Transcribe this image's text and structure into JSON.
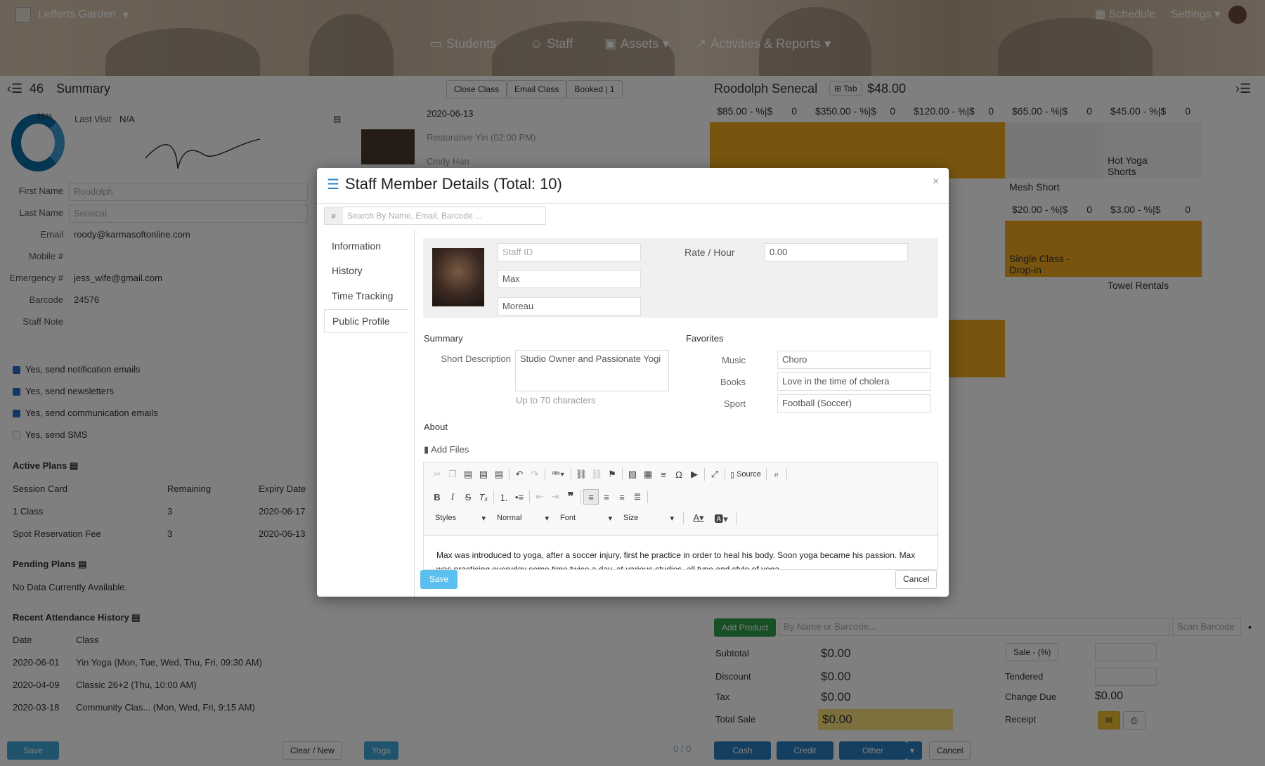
{
  "topbar": {
    "brand": "Lefferts Garden",
    "schedule": "Schedule",
    "settings": "Settings"
  },
  "mainnav": {
    "students": "Students",
    "staff": "Staff",
    "assets": "Assets",
    "activities": "Activities & Reports"
  },
  "left": {
    "count": "46",
    "title": "Summary",
    "percent": "29%",
    "last_visit_label": "Last Visit",
    "last_visit": "N/A",
    "fields": [
      {
        "label": "First Name",
        "value": "Roodolph"
      },
      {
        "label": "Last Name",
        "value": "Senecal"
      },
      {
        "label": "Email",
        "value": "roody@karmasoftonline.com"
      },
      {
        "label": "Mobile #",
        "value": ""
      },
      {
        "label": "Emergency #",
        "value": "jess_wife@gmail.com"
      },
      {
        "label": "Barcode",
        "value": "24576"
      },
      {
        "label": "Staff Note",
        "value": ""
      }
    ],
    "checks": [
      {
        "label": "Yes, send notification emails",
        "on": true
      },
      {
        "label": "Yes, send newsletters",
        "on": true
      },
      {
        "label": "Yes, send communication emails",
        "on": true
      },
      {
        "label": "Yes, send SMS",
        "on": false
      }
    ],
    "active_plans": {
      "title": "Active Plans",
      "headers": [
        "Session Card",
        "Remaining",
        "Expiry Date"
      ],
      "rows": [
        [
          "1 Class",
          "3",
          "2020-06-17"
        ],
        [
          "Spot Reservation Fee",
          "3",
          "2020-06-13"
        ]
      ]
    },
    "pending_plans": {
      "title": "Pending Plans",
      "empty": "No Data Currently Available."
    },
    "attendance": {
      "title": "Recent Attendance History",
      "headers": [
        "Date",
        "Class"
      ],
      "rows": [
        [
          "2020-06-01",
          "Yin Yoga (Mon, Tue, Wed, Thu, Fri, 09:30 AM)"
        ],
        [
          "2020-04-09",
          "Classic 26+2 (Thu, 10:00 AM)"
        ],
        [
          "2020-03-18",
          "Community Clas... (Mon, Wed, Fri, 9:15 AM)"
        ]
      ]
    },
    "save": "Save",
    "clear": "Clear / New"
  },
  "middle": {
    "close_class": "Close Class",
    "email_class": "Email Class",
    "booked": "Booked | 1",
    "date": "2020-06-13",
    "class": "Restorative Yin (02:00 PM)",
    "teacher": "Cindy Han",
    "tag": "Yoga",
    "paging": "0 / 0"
  },
  "right": {
    "customer": "Roodolph Senecal",
    "tab": "Tab",
    "balance": "$48.00",
    "row1": [
      {
        "price": "$85.00",
        "disc": "- %|$",
        "qty": "0",
        "color": "#f0a81c",
        "name": ""
      },
      {
        "price": "$350.00",
        "disc": "- %|$",
        "qty": "0",
        "color": "#f0a81c",
        "name": ""
      },
      {
        "price": "$120.00",
        "disc": "- %|$",
        "qty": "0",
        "color": "#f0a81c",
        "name": ""
      },
      {
        "price": "$65.00",
        "disc": "- %|$",
        "qty": "0",
        "color": "#eee",
        "name": "Mesh Short"
      },
      {
        "price": "$45.00",
        "disc": "- %|$",
        "qty": "0",
        "color": "#f4f4f4",
        "name": "Hot Yoga Shorts"
      }
    ],
    "row2": [
      {
        "price": "$20.00",
        "disc": "- %|$",
        "qty": "0",
        "name": "Single Class - Drop-in"
      },
      {
        "price": "$3.00",
        "disc": "- %|$",
        "qty": "0",
        "name": "Towel Rentals"
      }
    ],
    "add_product": "Add Product",
    "search_ph": "By Name or Barcode...",
    "scan_ph": "Scan Barcode",
    "totals": [
      {
        "label": "Subtotal",
        "value": "$0.00"
      },
      {
        "label": "Discount",
        "value": "$0.00"
      },
      {
        "label": "Tax",
        "value": "$0.00"
      },
      {
        "label": "Total Sale",
        "value": "$0.00"
      }
    ],
    "sale_btn": "Sale - (%)",
    "tendered": "Tendered",
    "change_due": "Change Due",
    "change_value": "$0.00",
    "receipt": "Receipt",
    "pay": {
      "cash": "Cash",
      "credit": "Credit",
      "other": "Other",
      "cancel": "Cancel"
    }
  },
  "modal": {
    "title": "Staff Member Details (Total: 10)",
    "search_placeholder": "Search By Name, Email, Barcode ...",
    "tabs": [
      "Information",
      "History",
      "Time Tracking",
      "Public Profile"
    ],
    "staff_id_placeholder": "Staff ID",
    "first_name": "Max",
    "last_name": "Moreau",
    "rate_label": "Rate / Hour",
    "rate_value": "0.00",
    "summary_title": "Summary",
    "short_desc_label": "Short Description",
    "short_desc": "Studio Owner and Passionate Yogi",
    "char_hint": "Up to 70 characters",
    "favorites_title": "Favorites",
    "favorites": [
      {
        "label": "Music",
        "value": "Choro"
      },
      {
        "label": "Books",
        "value": "Love in the time of cholera"
      },
      {
        "label": "Sport",
        "value": "Football (Soccer)"
      }
    ],
    "about_title": "About",
    "add_files": "Add Files",
    "editor": {
      "source": "Source",
      "styles": "Styles",
      "format": "Normal",
      "font": "Font",
      "size": "Size",
      "content": "Max was introduced to yoga, after a soccer injury, first he practice in order to heal his body. Soon yoga became his passion. Max was practicing everyday some time twice a day, at various studios, all type and style of yoga."
    },
    "save": "Save",
    "cancel": "Cancel"
  }
}
